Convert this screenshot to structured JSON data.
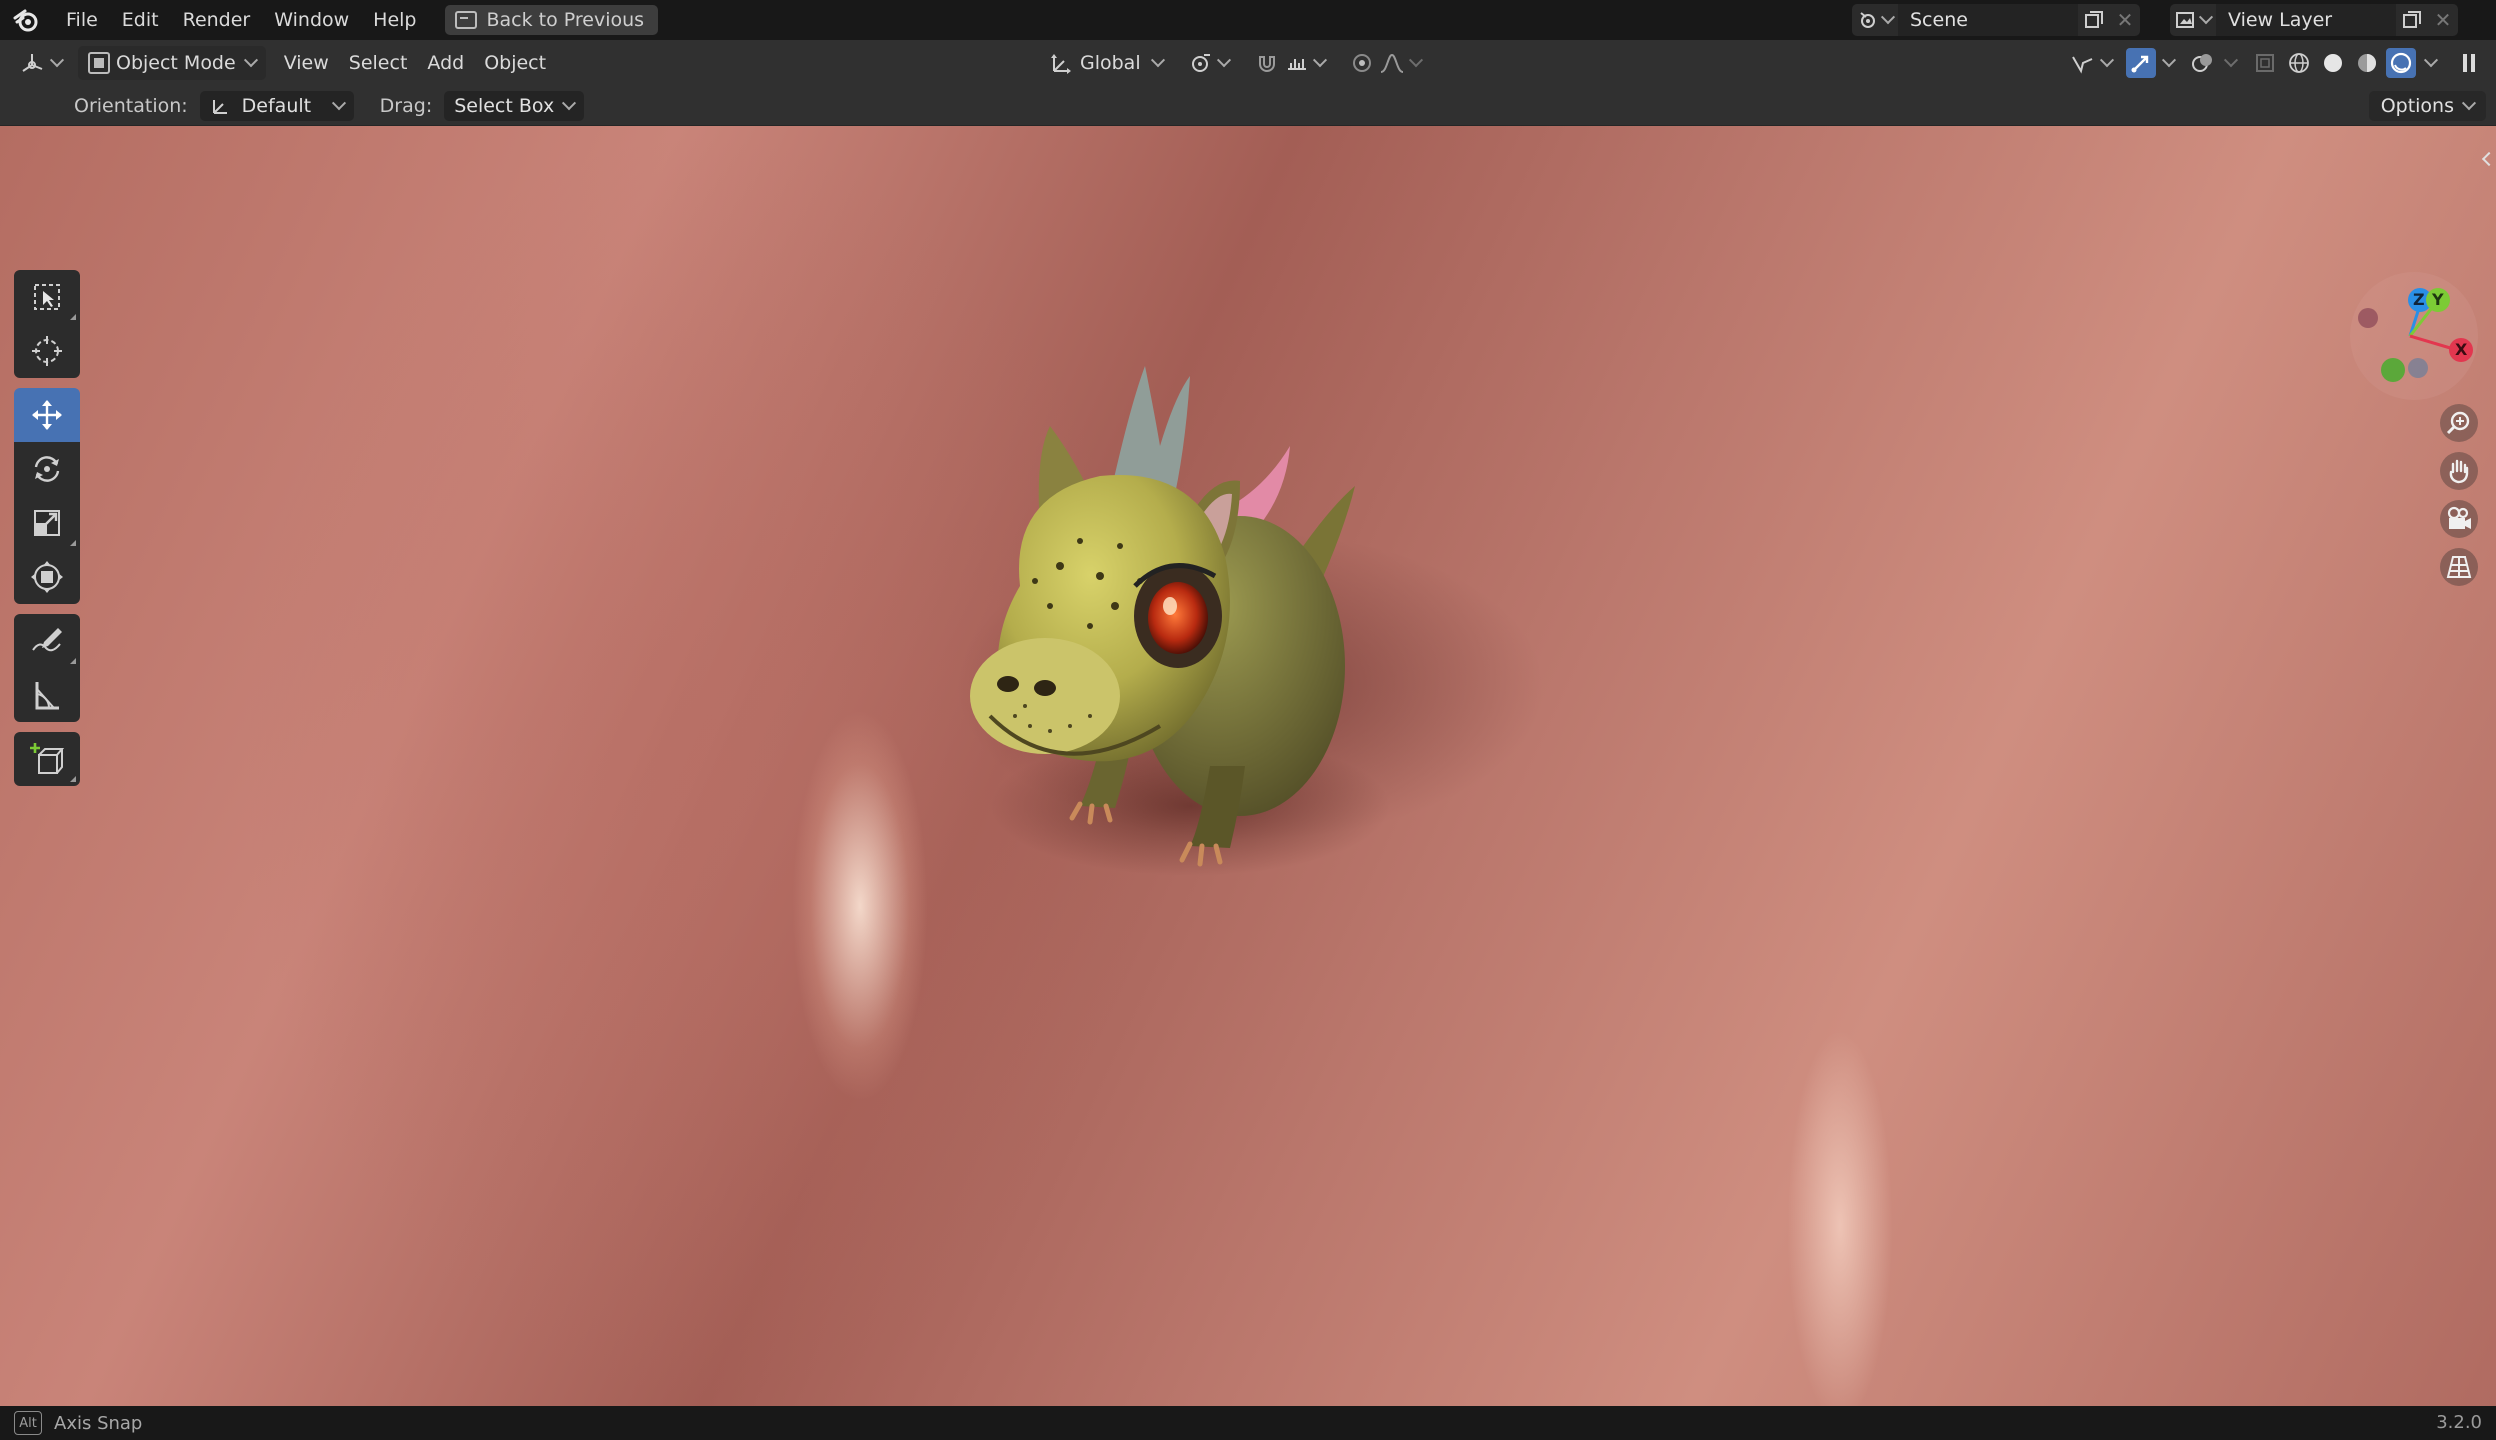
{
  "menubar": {
    "items": [
      "File",
      "Edit",
      "Render",
      "Window",
      "Help"
    ],
    "back_button": "Back to Previous",
    "scene_name": "Scene",
    "view_layer_name": "View Layer"
  },
  "header": {
    "mode": "Object Mode",
    "menus": [
      "View",
      "Select",
      "Add",
      "Object"
    ],
    "transform_orientation": "Global"
  },
  "tool_settings": {
    "orientation_label": "Orientation:",
    "orientation_value": "Default",
    "drag_label": "Drag:",
    "drag_value": "Select Box",
    "options_label": "Options"
  },
  "gizmo": {
    "axis_z": "Z",
    "axis_y": "Y",
    "axis_x": "X",
    "colors": {
      "x": "#e2374f",
      "y": "#7ccb35",
      "z": "#2a8fe6"
    }
  },
  "statusbar": {
    "key": "Alt",
    "hint": "Axis Snap",
    "version": "3.2.0"
  },
  "colors": {
    "accent": "#4772b3"
  }
}
